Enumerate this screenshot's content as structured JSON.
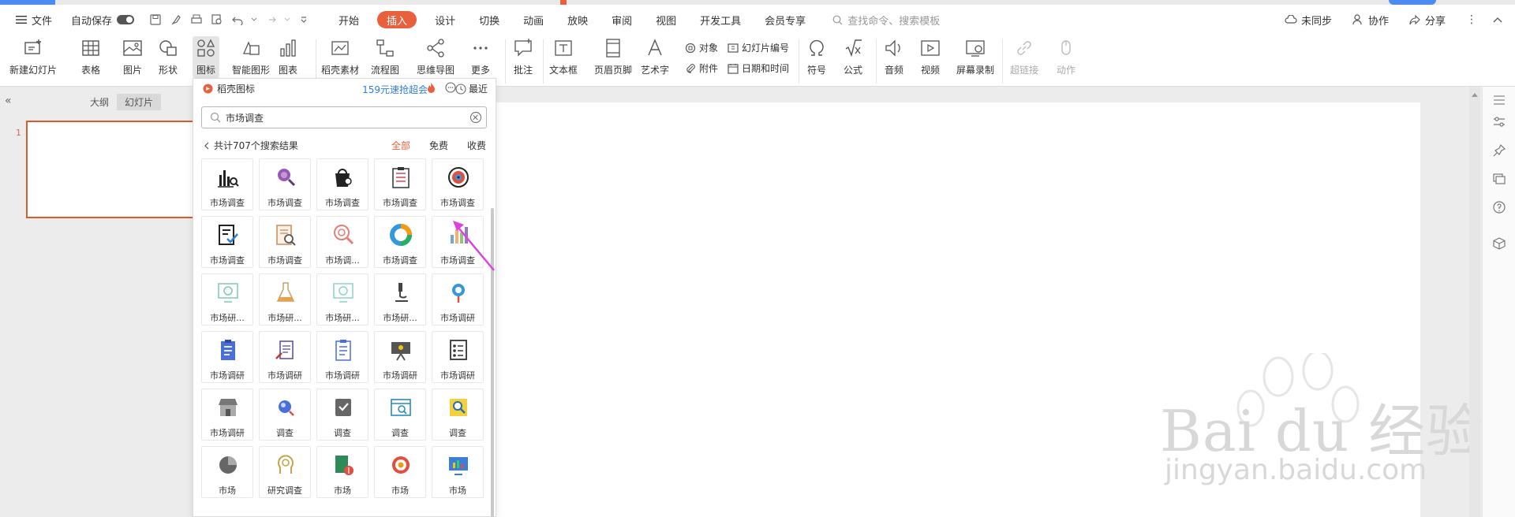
{
  "menubar": {
    "file": "文件",
    "autosave": "自动保存",
    "tabs": [
      "开始",
      "插入",
      "设计",
      "切换",
      "动画",
      "放映",
      "审阅",
      "视图",
      "开发工具",
      "会员专享"
    ],
    "active_tab": "插入",
    "search_placeholder": "查找命令、搜索模板",
    "sync": "未同步",
    "collab": "协作",
    "share": "分享"
  },
  "ribbon": {
    "new_slide": "新建幻灯片",
    "table": "表格",
    "picture": "图片",
    "shape": "形状",
    "icon": "图标",
    "smart_shape": "智能图形",
    "chart": "图表",
    "docer_assets": "稻壳素材",
    "flowchart": "流程图",
    "mindmap": "思维导图",
    "more": "更多",
    "comment": "批注",
    "textbox": "文本框",
    "header_footer": "页眉页脚",
    "wordart": "艺术字",
    "object": "对象",
    "attachment": "附件",
    "slide_number": "幻灯片编号",
    "date_time": "日期和时间",
    "symbol": "符号",
    "formula": "公式",
    "audio": "音频",
    "video": "视频",
    "screen_record": "屏幕录制",
    "hyperlink": "超链接",
    "action": "动作"
  },
  "leftpane": {
    "tab_outline": "大纲",
    "tab_slides": "幻灯片",
    "slide_number": "1"
  },
  "panel": {
    "title": "稻壳图标",
    "promo": "159元速抢超会",
    "recent": "最近",
    "search_value": "市场调查",
    "results": "共计707个搜索结果",
    "filters": [
      "全部",
      "免费",
      "收费"
    ],
    "active_filter": "全部",
    "icons": [
      "市场调查",
      "市场调查",
      "市场调查",
      "市场调查",
      "市场调查",
      "市场调查",
      "市场调查",
      "市场调...",
      "市场调查",
      "市场调查",
      "市场研...",
      "市场研...",
      "市场研...",
      "市场研...",
      "市场调研",
      "市场调研",
      "市场调研",
      "市场调研",
      "市场调研",
      "市场调研",
      "市场调研",
      "调查",
      "调查",
      "调查",
      "调查",
      "市场",
      "研究调查",
      "市场",
      "市场",
      "市场"
    ]
  },
  "watermark": {
    "text": "Bai du 经验",
    "url": "jingyan.baidu.com"
  },
  "colors": {
    "accent": "#e8613c",
    "link": "#2e7de1",
    "arrow": "#e040e0"
  }
}
